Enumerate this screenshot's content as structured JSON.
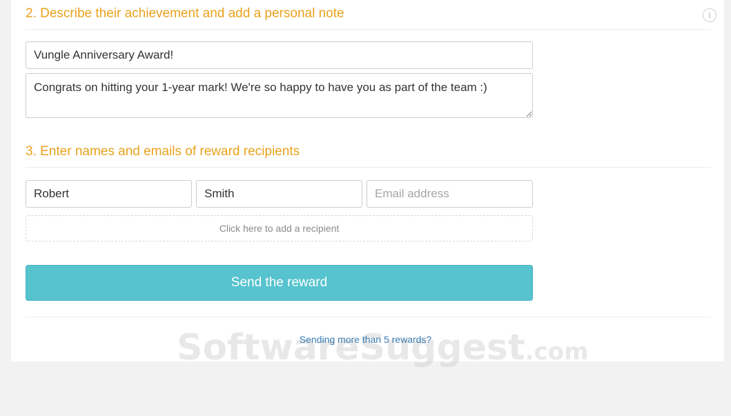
{
  "section2": {
    "title": "2. Describe their achievement and add a personal note",
    "award_title_value": "Vungle Anniversary Award!",
    "note_value": "Congrats on hitting your 1-year mark! We're so happy to have you as part of the team :)"
  },
  "section3": {
    "title": "3. Enter names and emails of reward recipients",
    "recipient": {
      "first_name_value": "Robert",
      "last_name_value": "Smith",
      "email_value": "",
      "email_placeholder": "Email address"
    },
    "add_recipient_label": "Click here to add a recipient"
  },
  "send_button_label": "Send the reward",
  "more_rewards_link": "Sending more than 5 rewards?",
  "watermark": {
    "main": "SoftwareSuggest",
    "tld": ".com"
  },
  "icons": {
    "info": "info-icon"
  },
  "colors": {
    "section_title": "#e8a21c",
    "send_button": "#56c3cf",
    "link": "#3a7bb0"
  }
}
